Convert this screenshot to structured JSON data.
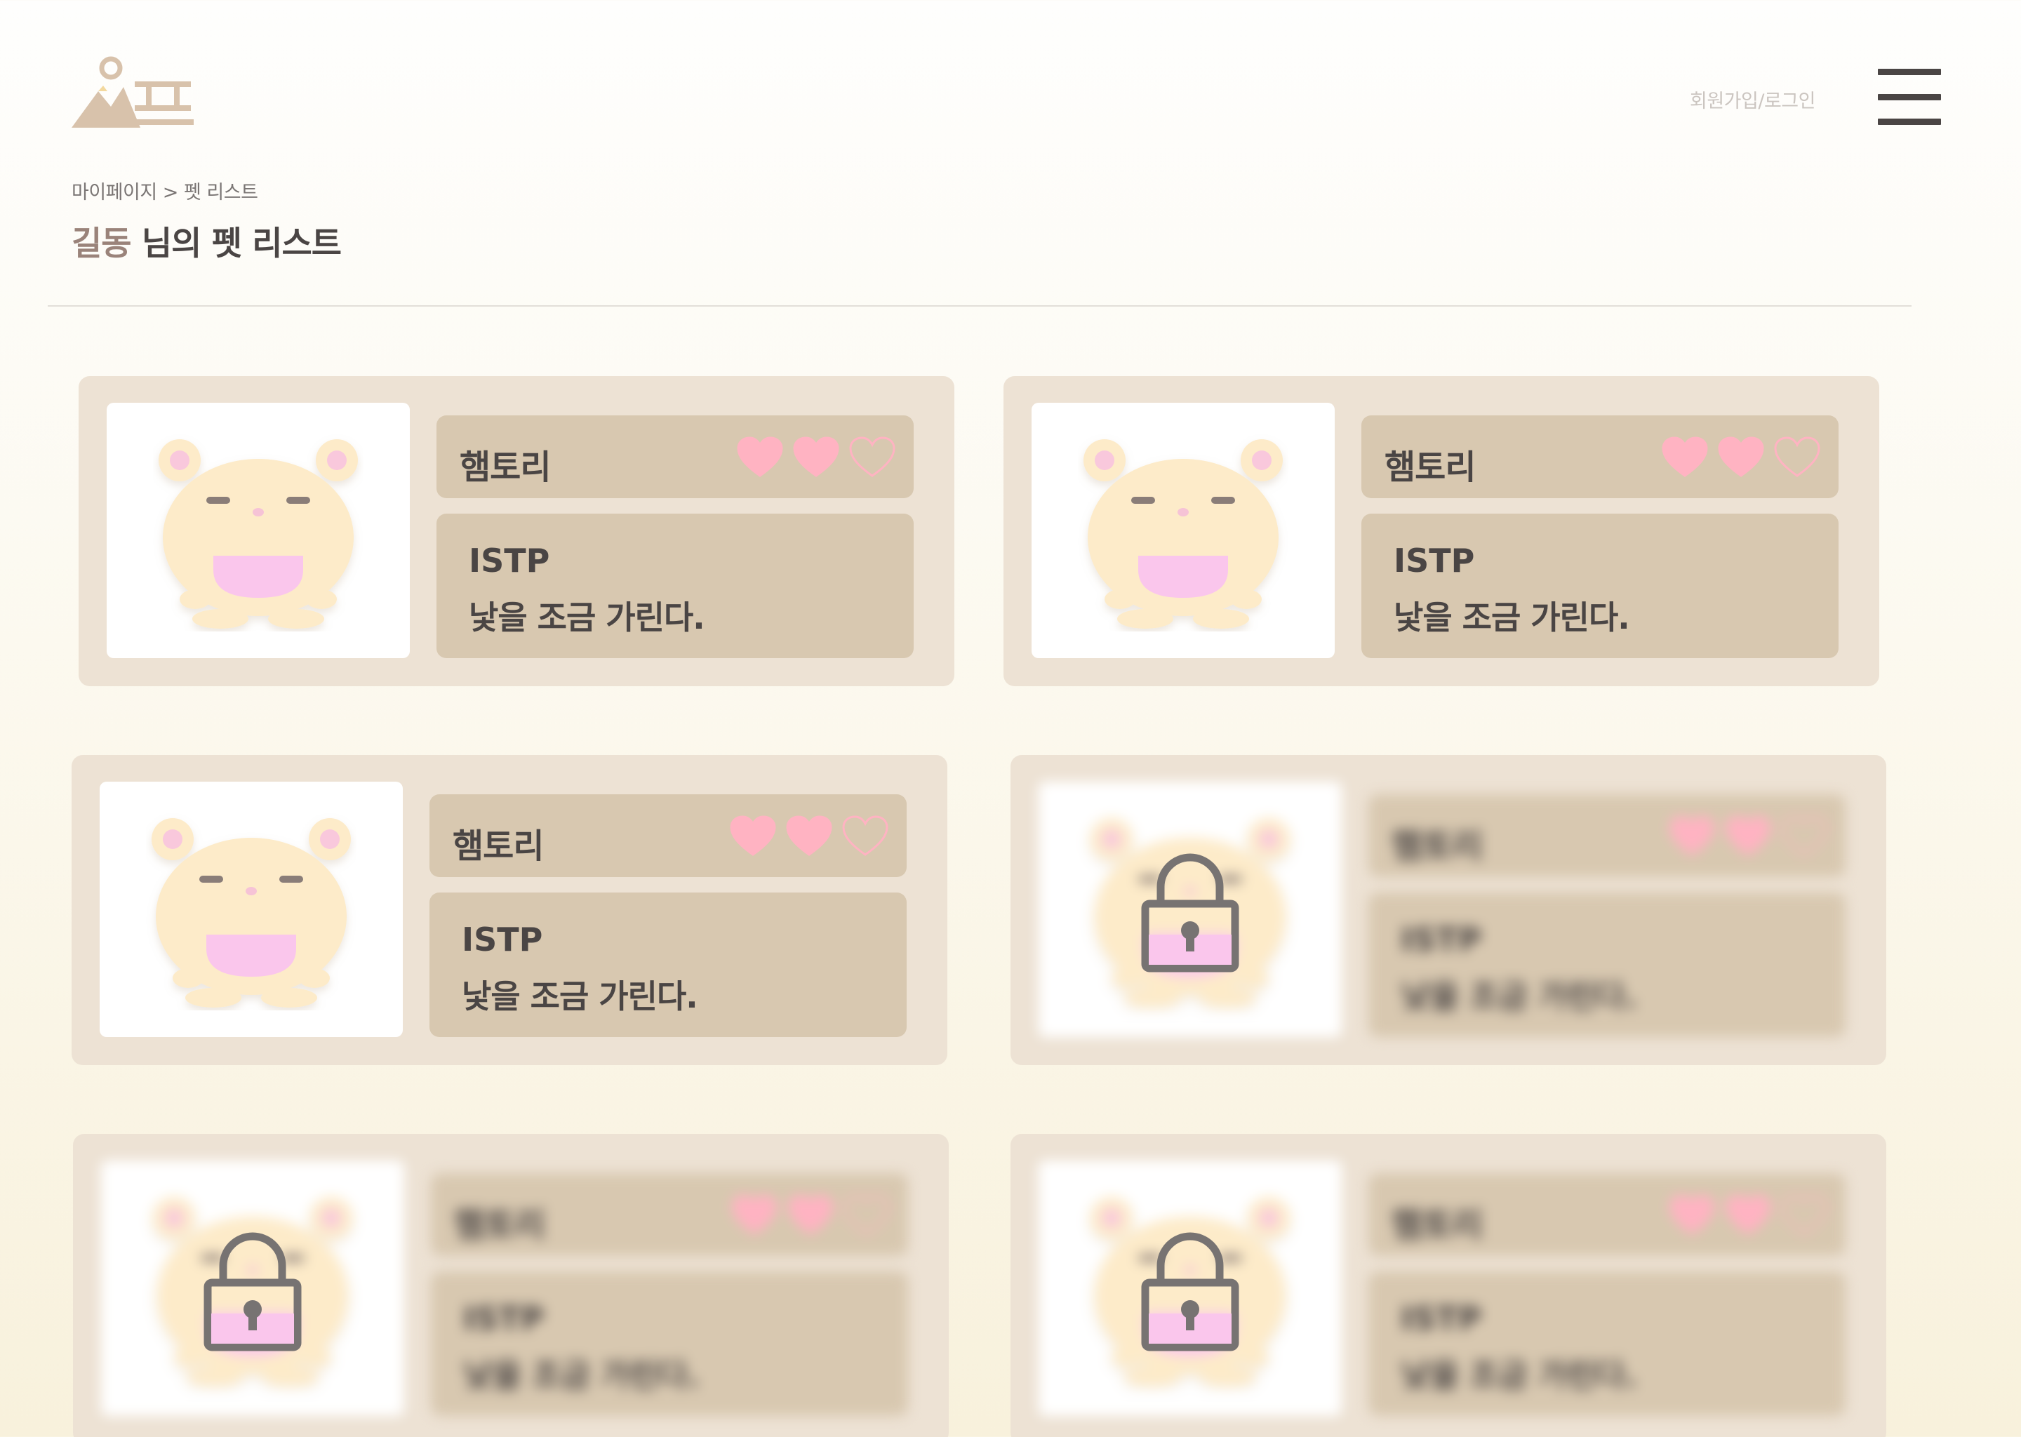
{
  "header": {
    "auth_link": "회원가입/로그인"
  },
  "breadcrumb": "마이페이지 > 펫 리스트",
  "title": {
    "user_name": "길동",
    "suffix": " 님의 펫 리스트"
  },
  "colors": {
    "accent": "#9a837a",
    "card_bg": "#ede2d4",
    "panel_bg": "#d8c8b0",
    "heart_pink": "#ffb3c2"
  },
  "pets": [
    {
      "name": "햄토리",
      "mbti": "ISTP",
      "description": "낯을 조금 가린다.",
      "hearts_filled": 2,
      "hearts_total": 3,
      "locked": false,
      "icon": "hamster-icon"
    },
    {
      "name": "햄토리",
      "mbti": "ISTP",
      "description": "낯을 조금 가린다.",
      "hearts_filled": 2,
      "hearts_total": 3,
      "locked": false,
      "icon": "hamster-icon"
    },
    {
      "name": "햄토리",
      "mbti": "ISTP",
      "description": "낯을 조금 가린다.",
      "hearts_filled": 2,
      "hearts_total": 3,
      "locked": false,
      "icon": "hamster-icon"
    },
    {
      "name": "햄토리",
      "mbti": "ISTP",
      "description": "낯을 조금 가린다.",
      "hearts_filled": 2,
      "hearts_total": 3,
      "locked": true,
      "icon": "lock-icon"
    },
    {
      "name": "햄토리",
      "mbti": "ISTP",
      "description": "낯을 조금 가린다.",
      "hearts_filled": 2,
      "hearts_total": 3,
      "locked": true,
      "icon": "lock-icon"
    },
    {
      "name": "햄토리",
      "mbti": "ISTP",
      "description": "낯을 조금 가린다.",
      "hearts_filled": 2,
      "hearts_total": 3,
      "locked": true,
      "icon": "lock-icon"
    }
  ]
}
